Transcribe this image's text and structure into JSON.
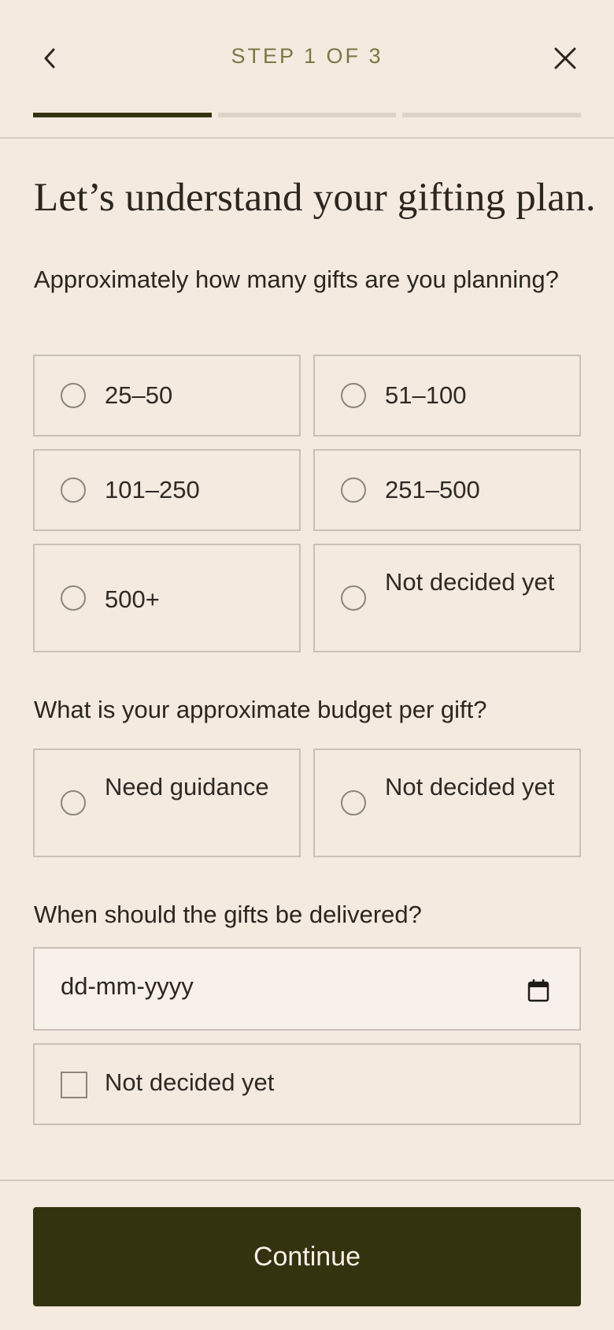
{
  "header": {
    "step_label": "STEP 1 OF 3",
    "progress": {
      "total_steps": 3,
      "current_step": 1
    }
  },
  "title": "Let’s understand your gifting plan.",
  "questions": {
    "gift_count": {
      "label": "Approximately how many gifts are you planning?",
      "options": [
        "25–50",
        "51–100",
        "101–250",
        "251–500",
        "500+",
        "Not decided yet"
      ]
    },
    "budget": {
      "label": "What is your approximate budget per gift?",
      "options": [
        "Need guidance",
        "Not decided yet"
      ]
    },
    "delivery": {
      "label": "When should the gifts be delivered?",
      "date_placeholder": "dd-mm-yyyy",
      "checkbox_label": "Not decided yet"
    }
  },
  "footer": {
    "continue_label": "Continue"
  },
  "colors": {
    "background": "#f4eadf",
    "accent": "#333310",
    "step_text": "#7b7645"
  }
}
